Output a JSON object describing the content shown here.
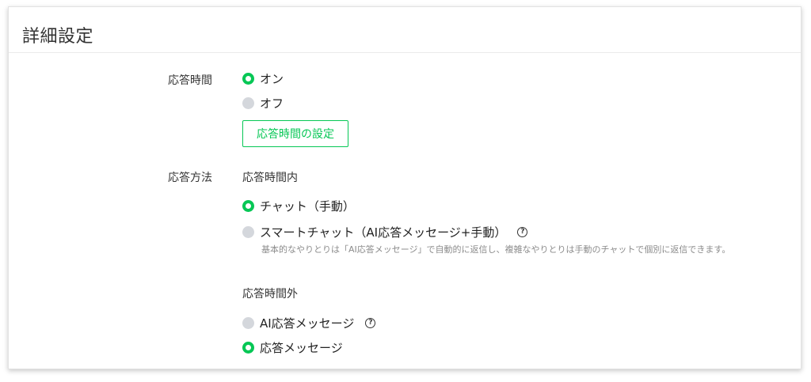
{
  "title": "詳細設定",
  "response_time": {
    "label": "応答時間",
    "options": [
      {
        "label": "オン",
        "selected": true
      },
      {
        "label": "オフ",
        "selected": false
      }
    ],
    "settings_button": "応答時間の設定"
  },
  "response_method": {
    "label": "応答方法",
    "within_hours": {
      "heading": "応答時間内",
      "options": [
        {
          "label": "チャット（手動）",
          "selected": true
        },
        {
          "label": "スマートチャット（AI応答メッセージ+手動）",
          "selected": false
        }
      ],
      "note": "基本的なやりとりは「AI応答メッセージ」で自動的に返信し、複雑なやりとりは手動のチャットで個別に返信できます。"
    },
    "outside_hours": {
      "heading": "応答時間外",
      "options": [
        {
          "label": "AI応答メッセージ",
          "selected": false
        },
        {
          "label": "応答メッセージ",
          "selected": true
        }
      ]
    }
  },
  "help_icon": {
    "glyph": "?"
  },
  "colors": {
    "accent": "#06c755",
    "radio_off": "#d4d7dc",
    "note_text": "#8c8c8c"
  }
}
